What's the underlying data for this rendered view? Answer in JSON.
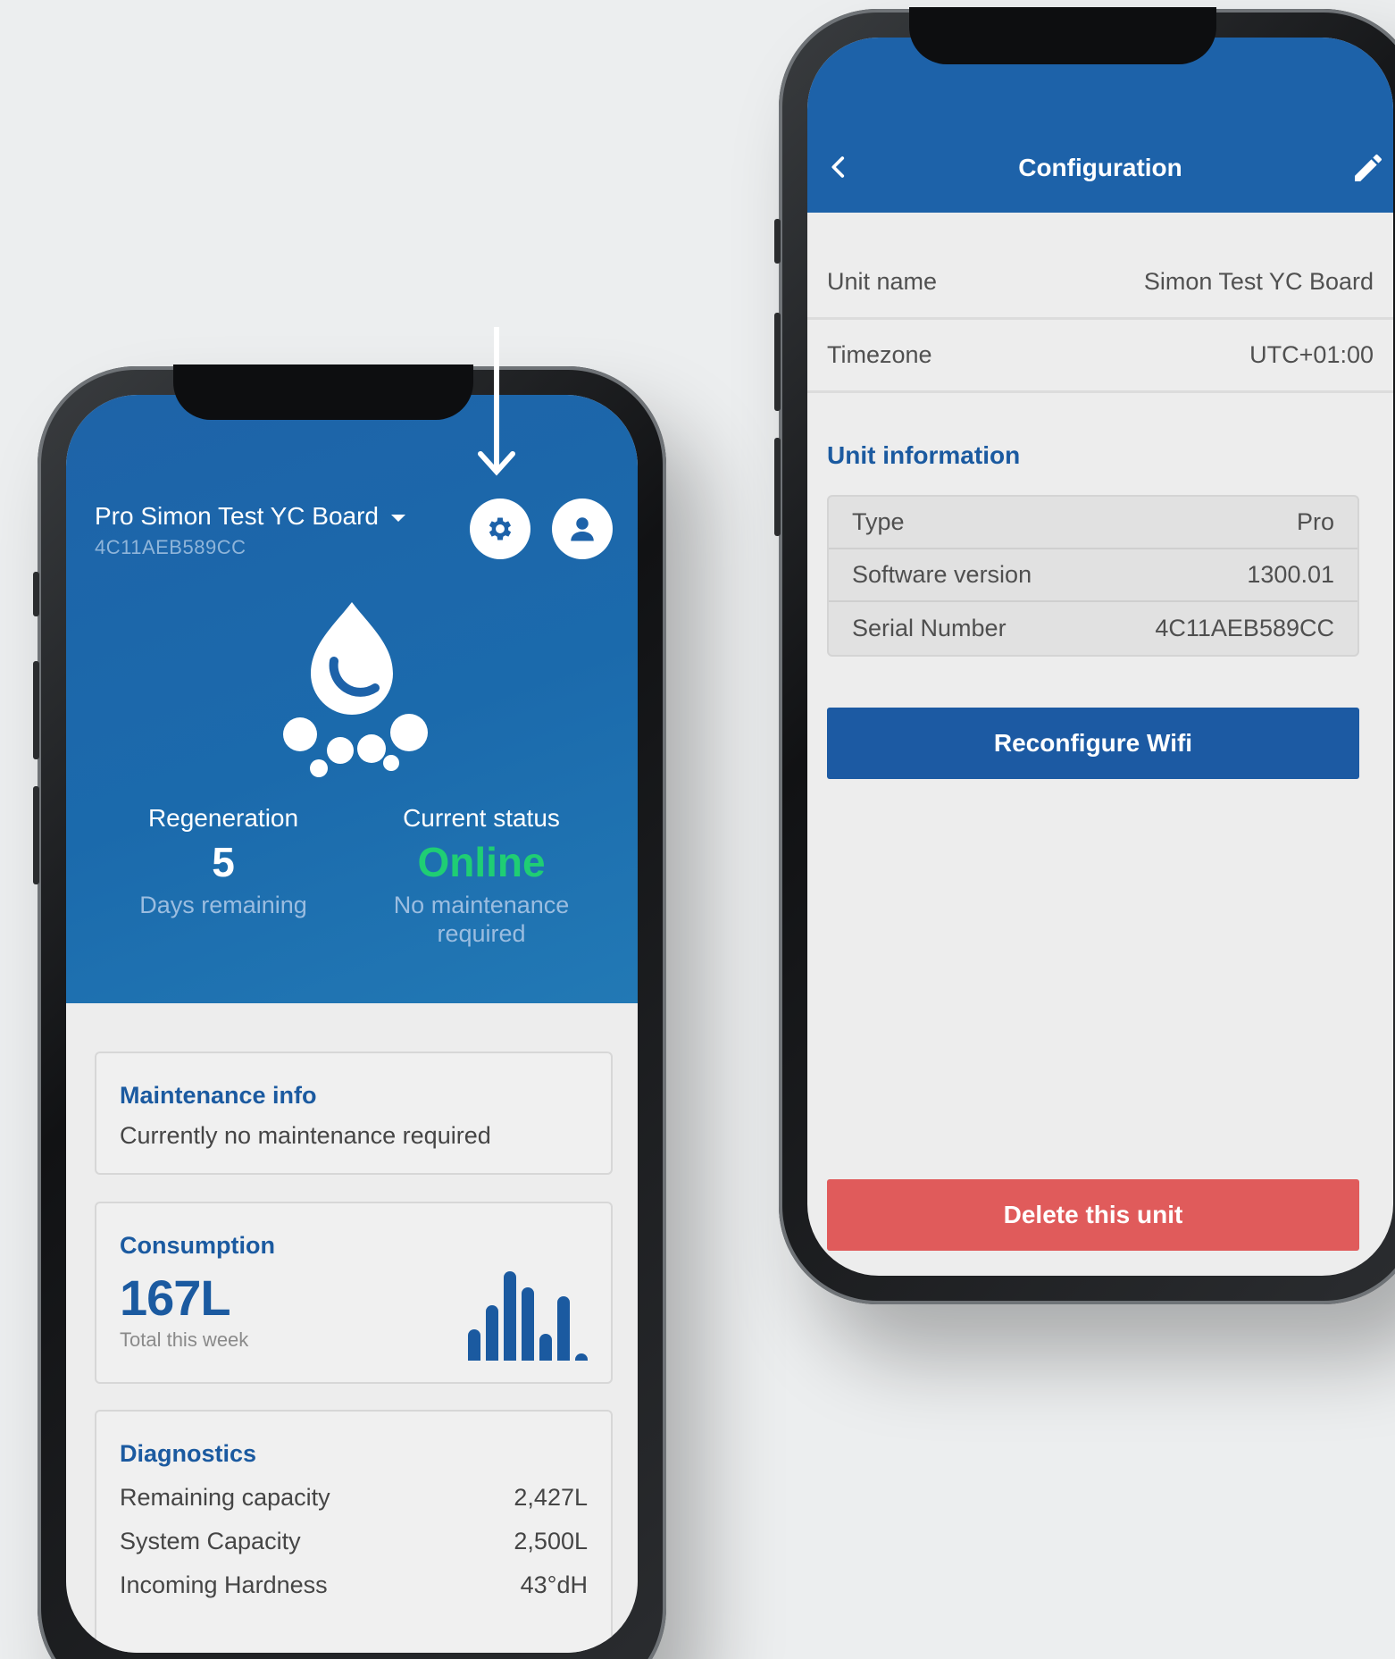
{
  "dashboard": {
    "unit_title": "Pro Simon Test YC Board",
    "unit_serial": "4C11AEB589CC",
    "regeneration": {
      "label": "Regeneration",
      "value": "5",
      "sub": "Days remaining"
    },
    "status": {
      "label": "Current status",
      "value": "Online",
      "sub": "No maintenance required"
    },
    "maintenance": {
      "title": "Maintenance info",
      "text": "Currently no maintenance required"
    },
    "consumption": {
      "title": "Consumption",
      "value": "167L",
      "sub": "Total this week",
      "bar_levels": [
        0.35,
        0.62,
        1.0,
        0.82,
        0.3,
        0.72,
        0.08
      ]
    },
    "diagnostics": {
      "title": "Diagnostics",
      "rows": [
        {
          "label": "Remaining capacity",
          "value": "2,427L"
        },
        {
          "label": "System Capacity",
          "value": "2,500L"
        },
        {
          "label": "Incoming Hardness",
          "value": "43°dH"
        }
      ]
    },
    "icons": {
      "settings": "gear-icon",
      "profile": "user-icon",
      "logo": "water-drop-icon",
      "unit_menu": "caret-down-icon"
    }
  },
  "configuration": {
    "title": "Configuration",
    "icons": {
      "back": "chevron-left-icon",
      "edit": "pencil-icon"
    },
    "unit_name": {
      "label": "Unit name",
      "value": "Simon Test YC Board"
    },
    "timezone": {
      "label": "Timezone",
      "value": "UTC+01:00"
    },
    "unit_information": {
      "title": "Unit information",
      "rows": [
        {
          "label": "Type",
          "value": "Pro"
        },
        {
          "label": "Software version",
          "value": "1300.01"
        },
        {
          "label": "Serial Number",
          "value": "4C11AEB589CC"
        }
      ]
    },
    "reconfigure_button": "Reconfigure Wifi",
    "delete_button": "Delete this unit"
  },
  "colors": {
    "brand_blue": "#1d62a9",
    "online_green": "#1fce74",
    "danger_red": "#e05b5b",
    "background": "#eceeef"
  }
}
